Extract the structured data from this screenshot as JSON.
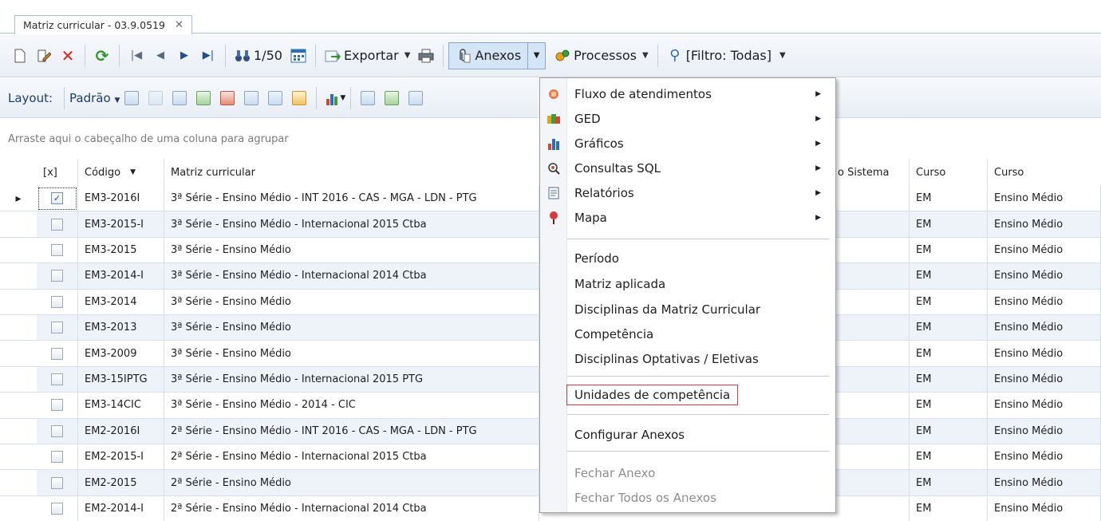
{
  "tab": {
    "title": "Matriz curricular - 03.9.0519",
    "close": "✕"
  },
  "toolbar": {
    "counter": "1/50",
    "exportar": "Exportar",
    "anexos": "Anexos",
    "processos": "Processos",
    "filtro": "[Filtro: Todas]"
  },
  "layoutbar": {
    "label": "Layout:",
    "padrao": "Padrão"
  },
  "grouppanel": {
    "hint": "Arraste aqui o cabeçalho de uma coluna para agrupar"
  },
  "grid": {
    "headers": {
      "sel": "[x]",
      "codigo": "Código",
      "matriz": "Matriz curricular",
      "sistema": "o Sistema",
      "curso1": "Curso",
      "curso2": "Curso"
    },
    "rows": [
      {
        "checked": "✓",
        "codigo": "EM3-2016I",
        "matriz": "3ª Série - Ensino Médio - INT 2016 - CAS - MGA - LDN - PTG",
        "curso": "EM",
        "curso_nome": "Ensino Médio"
      },
      {
        "checked": "",
        "codigo": "EM3-2015-I",
        "matriz": "3ª Série - Ensino Médio - Internacional 2015 Ctba",
        "curso": "EM",
        "curso_nome": "Ensino Médio"
      },
      {
        "checked": "",
        "codigo": "EM3-2015",
        "matriz": "3ª Série - Ensino Médio",
        "curso": "EM",
        "curso_nome": "Ensino Médio"
      },
      {
        "checked": "",
        "codigo": "EM3-2014-I",
        "matriz": "3ª Série - Ensino Médio - Internacional 2014 Ctba",
        "curso": "EM",
        "curso_nome": "Ensino Médio"
      },
      {
        "checked": "",
        "codigo": "EM3-2014",
        "matriz": "3ª Série - Ensino Médio",
        "curso": "EM",
        "curso_nome": "Ensino Médio"
      },
      {
        "checked": "",
        "codigo": "EM3-2013",
        "matriz": "3ª Série - Ensino Médio",
        "curso": "EM",
        "curso_nome": "Ensino Médio"
      },
      {
        "checked": "",
        "codigo": "EM3-2009",
        "matriz": "3ª Série - Ensino Médio",
        "curso": "EM",
        "curso_nome": "Ensino Médio"
      },
      {
        "checked": "",
        "codigo": "EM3-15IPTG",
        "matriz": "3ª Série - Ensino Médio - Internacional 2015 PTG",
        "curso": "EM",
        "curso_nome": "Ensino Médio"
      },
      {
        "checked": "",
        "codigo": "EM3-14CIC",
        "matriz": "3ª Série - Ensino Médio - 2014 - CIC",
        "curso": "EM",
        "curso_nome": "Ensino Médio"
      },
      {
        "checked": "",
        "codigo": "EM2-2016I",
        "matriz": "2ª Série - Ensino Médio - INT 2016 - CAS - MGA - LDN - PTG",
        "curso": "EM",
        "curso_nome": "Ensino Médio"
      },
      {
        "checked": "",
        "codigo": "EM2-2015-I",
        "matriz": "2ª Série - Ensino Médio - Internacional 2015 Ctba",
        "curso": "EM",
        "curso_nome": "Ensino Médio"
      },
      {
        "checked": "",
        "codigo": "EM2-2015",
        "matriz": "2ª Série - Ensino Médio",
        "curso": "EM",
        "curso_nome": "Ensino Médio"
      },
      {
        "checked": "",
        "codigo": "EM2-2014-I",
        "matriz": "2ª Série - Ensino Médio - Internacional 2014 Ctba",
        "curso": "EM",
        "curso_nome": "Ensino Médio"
      }
    ],
    "partial_value": "2"
  },
  "menu": {
    "items": [
      {
        "label": "Fluxo de atendimentos",
        "icon": "workflow-icon"
      },
      {
        "label": "GED",
        "icon": "ged-icon"
      },
      {
        "label": "Gráficos",
        "icon": "chart-icon"
      },
      {
        "label": "Consultas SQL",
        "icon": "sql-query-icon"
      },
      {
        "label": "Relatórios",
        "icon": "report-icon"
      },
      {
        "label": "Mapa",
        "icon": "map-pin-icon"
      }
    ],
    "plain": [
      "Período",
      "Matriz aplicada",
      "Disciplinas da Matriz Curricular",
      "Competência",
      "Disciplinas Optativas / Eletivas"
    ],
    "highlighted": "Unidades de competência",
    "configurar": "Configurar Anexos",
    "fechar": "Fechar Anexo",
    "fechar_todos": "Fechar Todos os Anexos"
  }
}
